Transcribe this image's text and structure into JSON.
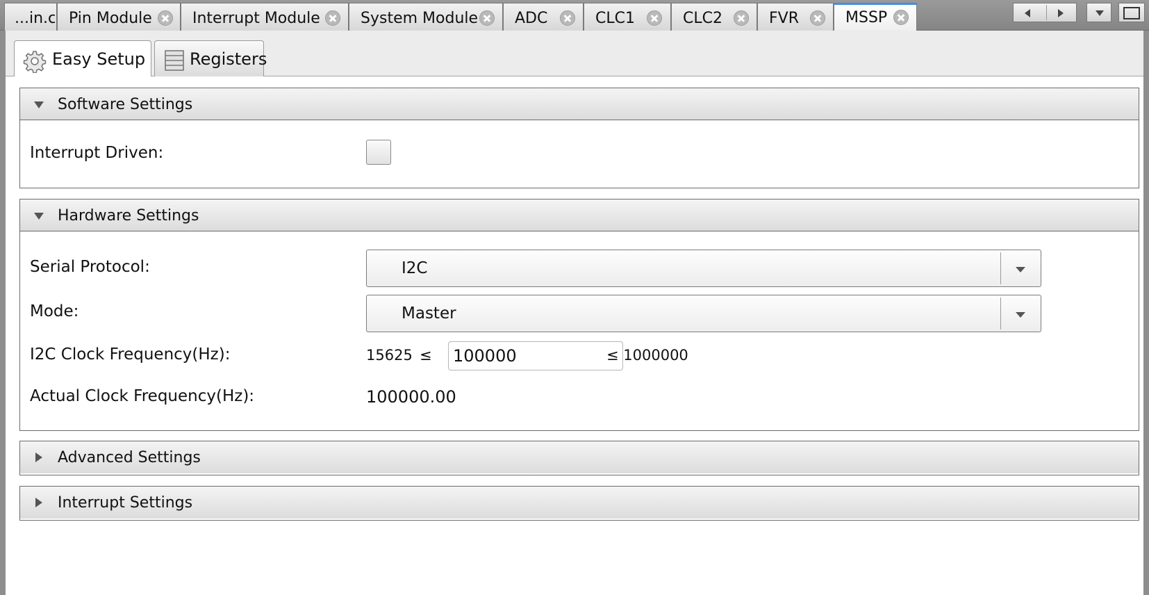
{
  "doc_tabs": [
    {
      "label": "...in.c",
      "active": false
    },
    {
      "label": "Pin Module",
      "active": false
    },
    {
      "label": "Interrupt Module",
      "active": false
    },
    {
      "label": "System Module",
      "active": false
    },
    {
      "label": "ADC",
      "active": false
    },
    {
      "label": "CLC1",
      "active": false
    },
    {
      "label": "CLC2",
      "active": false
    },
    {
      "label": "FVR",
      "active": false
    },
    {
      "label": "MSSP",
      "active": true
    }
  ],
  "view_tabs": [
    {
      "label": "Easy Setup",
      "icon": "gear-icon",
      "selected": true
    },
    {
      "label": "Registers",
      "icon": "registers-icon",
      "selected": false
    }
  ],
  "software_settings": {
    "title": "Software Settings",
    "interrupt_driven_label": "Interrupt Driven:",
    "interrupt_driven_checked": false
  },
  "hardware_settings": {
    "title": "Hardware Settings",
    "serial_protocol_label": "Serial Protocol:",
    "serial_protocol_value": "I2C",
    "mode_label": "Mode:",
    "mode_value": "Master",
    "clock_label": "I2C Clock Frequency(Hz):",
    "clock_min": "15625",
    "le_symbol": "≤",
    "clock_value": "100000",
    "clock_max": "≤ 1000000",
    "actual_label": "Actual Clock Frequency(Hz):",
    "actual_value": "100000.00"
  },
  "advanced_settings": {
    "title": "Advanced Settings"
  },
  "interrupt_settings": {
    "title": "Interrupt Settings"
  },
  "colors": {
    "active_tab_accent": "#3f8fe6",
    "chrome_gray": "#8e8e8e"
  }
}
